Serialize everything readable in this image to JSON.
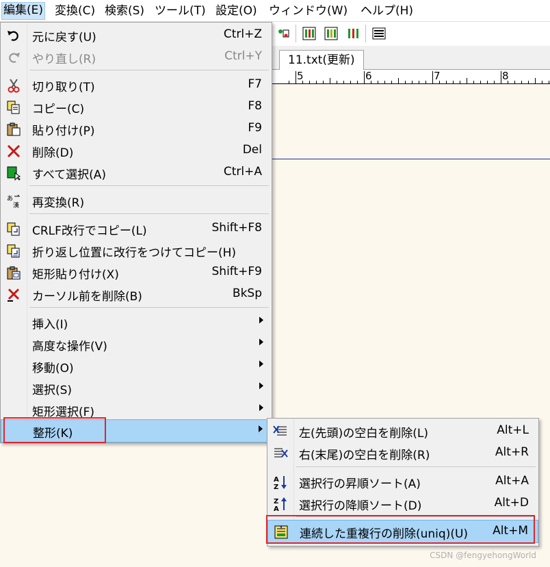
{
  "menubar": [
    {
      "label": "編集(E)",
      "active": true
    },
    {
      "label": "変換(C)"
    },
    {
      "label": "検索(S)"
    },
    {
      "label": "ツール(T)"
    },
    {
      "label": "設定(O)"
    },
    {
      "label": "ウィンドウ(W)"
    },
    {
      "label": "ヘルプ(H)"
    }
  ],
  "tab": {
    "label": "11.txt(更新)"
  },
  "ruler": {
    "labels": [
      "5",
      "6",
      "7",
      "8"
    ]
  },
  "edit_menu": {
    "items": [
      {
        "label": "元に戻す(U)",
        "shortcut": "Ctrl+Z",
        "icon": "undo-icon"
      },
      {
        "label": "やり直し(R)",
        "shortcut": "Ctrl+Y",
        "icon": "redo-icon",
        "disabled": true
      },
      {
        "label": "切り取り(T)",
        "shortcut": "F7",
        "icon": "scissors-icon"
      },
      {
        "label": "コピー(C)",
        "shortcut": "F8",
        "icon": "copy-icon"
      },
      {
        "label": "貼り付け(P)",
        "shortcut": "F9",
        "icon": "paste-icon"
      },
      {
        "label": "削除(D)",
        "shortcut": "Del",
        "icon": "delete-icon"
      },
      {
        "label": "すべて選択(A)",
        "shortcut": "Ctrl+A",
        "icon": "select-all-icon"
      },
      {
        "label": "再変換(R)",
        "shortcut": "",
        "icon": "reconvert-icon"
      },
      {
        "label": "CRLF改行でコピー(L)",
        "shortcut": "Shift+F8",
        "icon": "copy-crlf-icon"
      },
      {
        "label": "折り返し位置に改行をつけてコピー(H)",
        "shortcut": "",
        "icon": "copy-wrap-icon"
      },
      {
        "label": "矩形貼り付け(X)",
        "shortcut": "Shift+F9",
        "icon": "paste-box-icon"
      },
      {
        "label": "カーソル前を削除(B)",
        "shortcut": "BkSp",
        "icon": "backspace-icon"
      },
      {
        "label": "挿入(I)",
        "submenu": true
      },
      {
        "label": "高度な操作(V)",
        "submenu": true
      },
      {
        "label": "移動(O)",
        "submenu": true
      },
      {
        "label": "選択(S)",
        "submenu": true
      },
      {
        "label": "矩形選択(F)",
        "submenu": true
      },
      {
        "label": "整形(K)",
        "submenu": true,
        "highlighted": true
      }
    ]
  },
  "format_submenu": {
    "items": [
      {
        "label": "左(先頭)の空白を削除(L)",
        "shortcut": "Alt+L",
        "icon": "trim-left-icon"
      },
      {
        "label": "右(末尾)の空白を削除(R)",
        "shortcut": "Alt+R",
        "icon": "trim-right-icon"
      },
      {
        "label": "選択行の昇順ソート(A)",
        "shortcut": "Alt+A",
        "icon": "sort-asc-icon"
      },
      {
        "label": "選択行の降順ソート(D)",
        "shortcut": "Alt+D",
        "icon": "sort-desc-icon"
      },
      {
        "label": "連続した重複行の削除(uniq)(U)",
        "shortcut": "Alt+M",
        "icon": "uniq-icon",
        "highlighted": true
      }
    ]
  },
  "watermark": "CSDN @fengyehongWorld",
  "colors": {
    "highlight": "#a9d5f7",
    "red_box": "#e0242c",
    "editor_bg": "#fdf8ee"
  }
}
